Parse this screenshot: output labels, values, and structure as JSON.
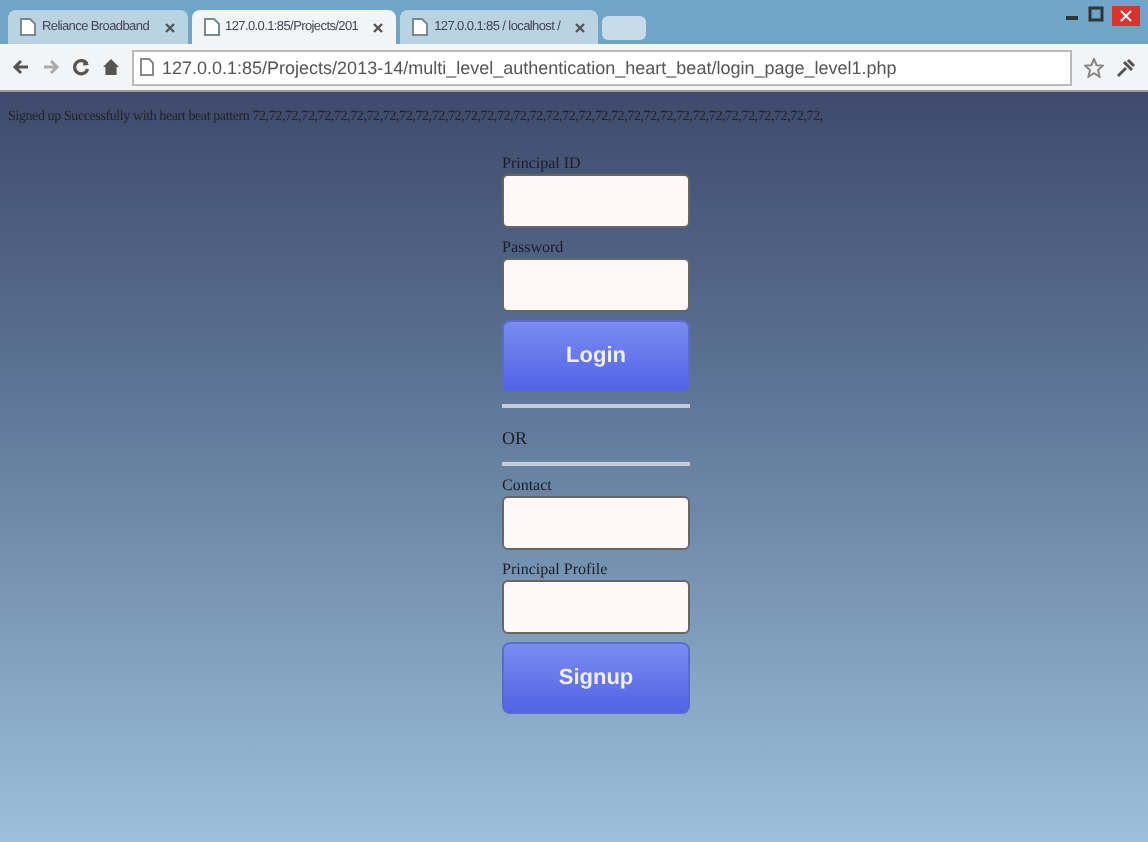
{
  "browser": {
    "tabs": [
      {
        "label": "Reliance Broadband",
        "selected": false
      },
      {
        "label": "127.0.0.1:85/Projects/201",
        "selected": true
      },
      {
        "label": "127.0.0.1:85 / localhost /",
        "selected": false
      }
    ],
    "url": "127.0.0.1:85/Projects/2013-14/multi_level_authentication_heart_beat/login_page_level1.php"
  },
  "status_message": "Signed up Successfully with heart beat pattern 72,72,72,72,72,72,72,72,72,72,72,72,72,72,72,72,72,72,72,72,72,72,72,72,72,72,72,72,72,72,72,72,72,72,72,",
  "form": [
    {
      "kind": "field",
      "label": "Principal ID"
    },
    {
      "kind": "field",
      "label": "Password"
    },
    {
      "kind": "button",
      "label": "Login"
    },
    {
      "kind": "divider"
    },
    {
      "kind": "heading",
      "label": "OR"
    },
    {
      "kind": "divider"
    },
    {
      "kind": "field",
      "label": "Contact"
    },
    {
      "kind": "field",
      "label": "Principal Profile"
    },
    {
      "kind": "button",
      "label": "Signup"
    }
  ]
}
